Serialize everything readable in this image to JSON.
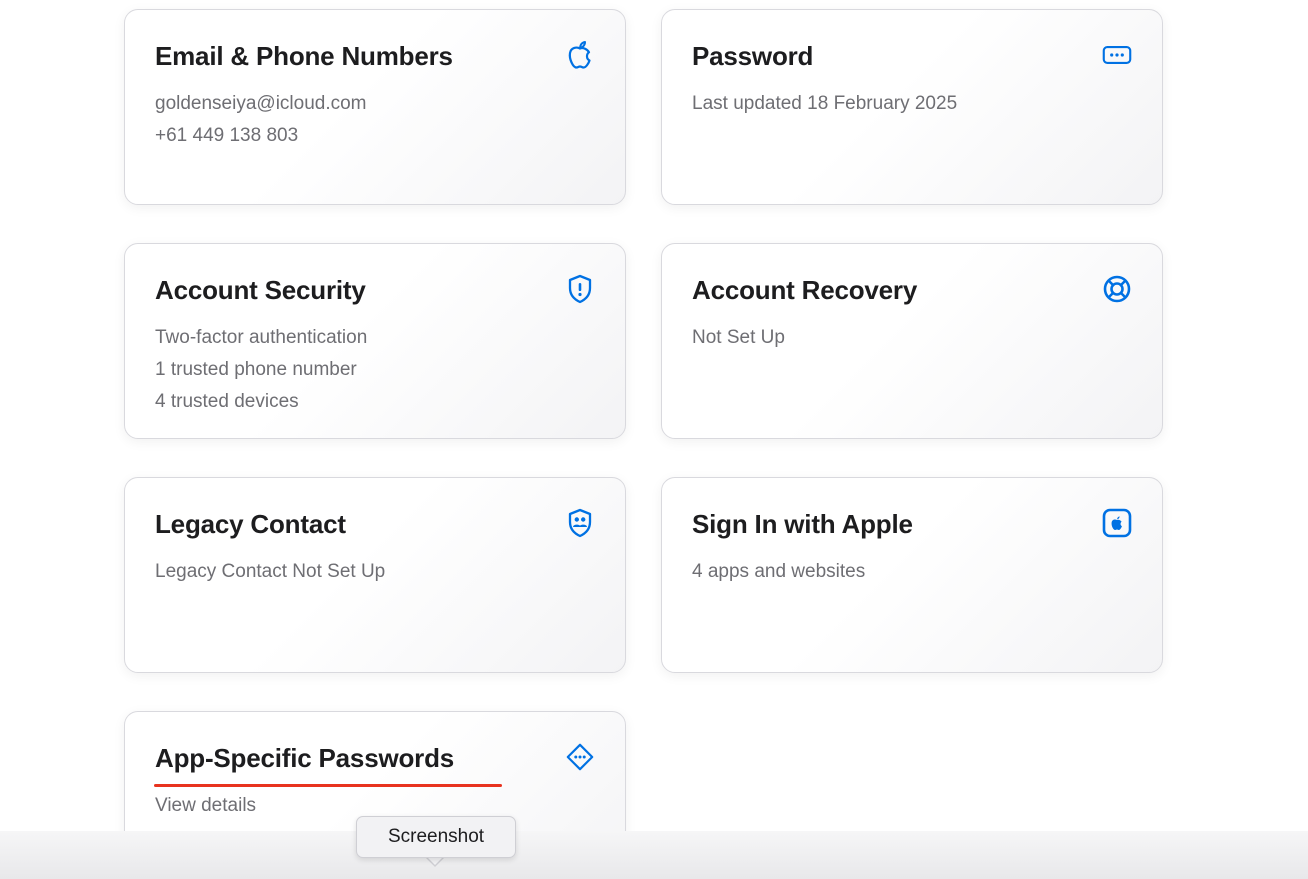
{
  "accent_color": "#0071e3",
  "highlight_color": "#e8331f",
  "cards": [
    {
      "title": "Email & Phone Numbers",
      "icon": "apple-logo-icon",
      "lines": [
        "goldenseiya@icloud.com",
        "+61 449 138 803"
      ]
    },
    {
      "title": "Password",
      "icon": "password-dots-icon",
      "lines": [
        "Last updated 18 February 2025"
      ]
    },
    {
      "title": "Account Security",
      "icon": "shield-icon",
      "lines": [
        "Two-factor authentication",
        "1 trusted phone number",
        "4 trusted devices"
      ]
    },
    {
      "title": "Account Recovery",
      "icon": "lifebuoy-icon",
      "lines": [
        "Not Set Up"
      ]
    },
    {
      "title": "Legacy Contact",
      "icon": "legacy-contact-shield-icon",
      "lines": [
        "Legacy Contact Not Set Up"
      ]
    },
    {
      "title": "Sign In with Apple",
      "icon": "apple-square-icon",
      "lines": [
        "4 apps and websites"
      ]
    },
    {
      "title": "App-Specific Passwords",
      "icon": "key-diamond-icon",
      "lines": [
        "View details"
      ]
    }
  ],
  "tooltip": {
    "label": "Screenshot"
  }
}
